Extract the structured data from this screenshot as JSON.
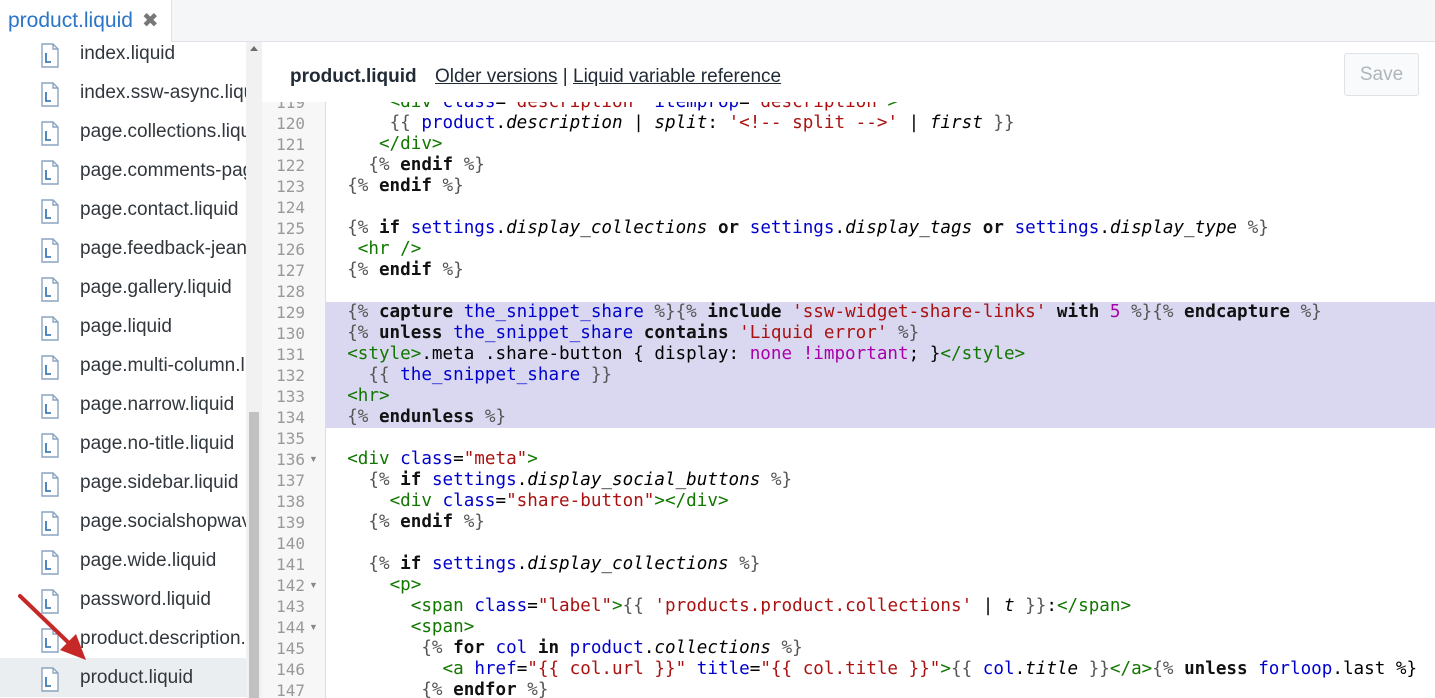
{
  "tab": {
    "label": "product.liquid",
    "close": "✖"
  },
  "sidebar": {
    "files": [
      {
        "label": "index.liquid"
      },
      {
        "label": "index.ssw-async.liquid"
      },
      {
        "label": "page.collections.liquid"
      },
      {
        "label": "page.comments-page.liquid"
      },
      {
        "label": "page.contact.liquid"
      },
      {
        "label": "page.feedback-jeans.liquid"
      },
      {
        "label": "page.gallery.liquid"
      },
      {
        "label": "page.liquid"
      },
      {
        "label": "page.multi-column.liquid"
      },
      {
        "label": "page.narrow.liquid"
      },
      {
        "label": "page.no-title.liquid"
      },
      {
        "label": "page.sidebar.liquid"
      },
      {
        "label": "page.socialshopwave.liquid"
      },
      {
        "label": "page.wide.liquid"
      },
      {
        "label": "password.liquid"
      },
      {
        "label": "product.description.liquid"
      },
      {
        "label": "product.liquid",
        "active": true
      }
    ]
  },
  "header": {
    "title": "product.liquid",
    "older_versions": "Older versions",
    "separator": " | ",
    "liquid_reference": "Liquid variable reference",
    "save": "Save"
  },
  "code": {
    "lines": [
      {
        "n": "119",
        "fold": false,
        "sel": false,
        "tokens": [
          [
            "t-txt",
            "      "
          ],
          [
            "t-tag",
            "<div"
          ],
          [
            "t-txt",
            " "
          ],
          [
            "t-attr",
            "class"
          ],
          [
            "t-txt",
            "="
          ],
          [
            "t-str",
            "\"description\""
          ],
          [
            "t-txt",
            " "
          ],
          [
            "t-attr",
            "itemprop"
          ],
          [
            "t-txt",
            "="
          ],
          [
            "t-str",
            "\"description\""
          ],
          [
            "t-tag",
            ">"
          ]
        ]
      },
      {
        "n": "120",
        "fold": false,
        "sel": false,
        "tokens": [
          [
            "t-txt",
            "      "
          ],
          [
            "t-br",
            "{{"
          ],
          [
            "t-txt",
            " "
          ],
          [
            "t-var",
            "product"
          ],
          [
            "t-txt",
            "."
          ],
          [
            "t-prop",
            "description"
          ],
          [
            "t-txt",
            " | "
          ],
          [
            "t-filter",
            "split"
          ],
          [
            "t-txt",
            ": "
          ],
          [
            "t-str",
            "'<!-- split -->'"
          ],
          [
            "t-txt",
            " | "
          ],
          [
            "t-filter",
            "first"
          ],
          [
            "t-txt",
            " "
          ],
          [
            "t-br",
            "}}"
          ]
        ]
      },
      {
        "n": "121",
        "fold": false,
        "sel": false,
        "tokens": [
          [
            "t-txt",
            "     "
          ],
          [
            "t-tag",
            "</div>"
          ]
        ]
      },
      {
        "n": "122",
        "fold": false,
        "sel": false,
        "tokens": [
          [
            "t-txt",
            "    "
          ],
          [
            "t-br",
            "{%"
          ],
          [
            "t-txt",
            " "
          ],
          [
            "t-kw",
            "endif"
          ],
          [
            "t-txt",
            " "
          ],
          [
            "t-br",
            "%}"
          ]
        ]
      },
      {
        "n": "123",
        "fold": false,
        "sel": false,
        "tokens": [
          [
            "t-txt",
            "  "
          ],
          [
            "t-br",
            "{%"
          ],
          [
            "t-txt",
            " "
          ],
          [
            "t-kw",
            "endif"
          ],
          [
            "t-txt",
            " "
          ],
          [
            "t-br",
            "%}"
          ]
        ]
      },
      {
        "n": "124",
        "fold": false,
        "sel": false,
        "tokens": []
      },
      {
        "n": "125",
        "fold": false,
        "sel": false,
        "tokens": [
          [
            "t-txt",
            "  "
          ],
          [
            "t-br",
            "{%"
          ],
          [
            "t-txt",
            " "
          ],
          [
            "t-kw",
            "if"
          ],
          [
            "t-txt",
            " "
          ],
          [
            "t-var",
            "settings"
          ],
          [
            "t-txt",
            "."
          ],
          [
            "t-prop",
            "display_collections"
          ],
          [
            "t-txt",
            " "
          ],
          [
            "t-kw",
            "or"
          ],
          [
            "t-txt",
            " "
          ],
          [
            "t-var",
            "settings"
          ],
          [
            "t-txt",
            "."
          ],
          [
            "t-prop",
            "display_tags"
          ],
          [
            "t-txt",
            " "
          ],
          [
            "t-kw",
            "or"
          ],
          [
            "t-txt",
            " "
          ],
          [
            "t-var",
            "settings"
          ],
          [
            "t-txt",
            "."
          ],
          [
            "t-prop",
            "display_type"
          ],
          [
            "t-txt",
            " "
          ],
          [
            "t-br",
            "%}"
          ]
        ]
      },
      {
        "n": "126",
        "fold": false,
        "sel": false,
        "tokens": [
          [
            "t-txt",
            "   "
          ],
          [
            "t-tag",
            "<hr />"
          ]
        ]
      },
      {
        "n": "127",
        "fold": false,
        "sel": false,
        "tokens": [
          [
            "t-txt",
            "  "
          ],
          [
            "t-br",
            "{%"
          ],
          [
            "t-txt",
            " "
          ],
          [
            "t-kw",
            "endif"
          ],
          [
            "t-txt",
            " "
          ],
          [
            "t-br",
            "%}"
          ]
        ]
      },
      {
        "n": "128",
        "fold": false,
        "sel": false,
        "tokens": []
      },
      {
        "n": "129",
        "fold": false,
        "sel": true,
        "tokens": [
          [
            "t-txt",
            "  "
          ],
          [
            "t-br",
            "{%"
          ],
          [
            "t-txt",
            " "
          ],
          [
            "t-kw",
            "capture"
          ],
          [
            "t-txt",
            " "
          ],
          [
            "t-var",
            "the_snippet_share"
          ],
          [
            "t-txt",
            " "
          ],
          [
            "t-br",
            "%}{%"
          ],
          [
            "t-txt",
            " "
          ],
          [
            "t-kw",
            "include"
          ],
          [
            "t-txt",
            " "
          ],
          [
            "t-str",
            "'ssw-widget-share-links'"
          ],
          [
            "t-txt",
            " "
          ],
          [
            "t-kw",
            "with"
          ],
          [
            "t-txt",
            " "
          ],
          [
            "t-num",
            "5"
          ],
          [
            "t-txt",
            " "
          ],
          [
            "t-br",
            "%}{%"
          ],
          [
            "t-txt",
            " "
          ],
          [
            "t-kw",
            "endcapture"
          ],
          [
            "t-txt",
            " "
          ],
          [
            "t-br",
            "%}"
          ]
        ]
      },
      {
        "n": "130",
        "fold": false,
        "sel": true,
        "tokens": [
          [
            "t-txt",
            "  "
          ],
          [
            "t-br",
            "{%"
          ],
          [
            "t-txt",
            " "
          ],
          [
            "t-kw",
            "unless"
          ],
          [
            "t-txt",
            " "
          ],
          [
            "t-var",
            "the_snippet_share"
          ],
          [
            "t-txt",
            " "
          ],
          [
            "t-kw",
            "contains"
          ],
          [
            "t-txt",
            " "
          ],
          [
            "t-str",
            "'Liquid error'"
          ],
          [
            "t-txt",
            " "
          ],
          [
            "t-br",
            "%}"
          ]
        ]
      },
      {
        "n": "131",
        "fold": false,
        "sel": true,
        "tokens": [
          [
            "t-txt",
            "  "
          ],
          [
            "t-tag",
            "<style>"
          ],
          [
            "t-txt",
            ".meta .share-button { display: "
          ],
          [
            "t-atom",
            "none"
          ],
          [
            "t-txt",
            " "
          ],
          [
            "t-atom",
            "!important"
          ],
          [
            "t-txt",
            "; }"
          ],
          [
            "t-tag",
            "</style>"
          ]
        ]
      },
      {
        "n": "132",
        "fold": false,
        "sel": true,
        "tokens": [
          [
            "t-txt",
            "    "
          ],
          [
            "t-br",
            "{{"
          ],
          [
            "t-txt",
            " "
          ],
          [
            "t-var",
            "the_snippet_share"
          ],
          [
            "t-txt",
            " "
          ],
          [
            "t-br",
            "}}"
          ]
        ]
      },
      {
        "n": "133",
        "fold": false,
        "sel": true,
        "tokens": [
          [
            "t-txt",
            "  "
          ],
          [
            "t-tag",
            "<hr>"
          ]
        ]
      },
      {
        "n": "134",
        "fold": false,
        "sel": true,
        "tokens": [
          [
            "t-txt",
            "  "
          ],
          [
            "t-br",
            "{%"
          ],
          [
            "t-txt",
            " "
          ],
          [
            "t-kw",
            "endunless"
          ],
          [
            "t-txt",
            " "
          ],
          [
            "t-br",
            "%}"
          ]
        ]
      },
      {
        "n": "135",
        "fold": false,
        "sel": false,
        "tokens": []
      },
      {
        "n": "136",
        "fold": true,
        "sel": false,
        "tokens": [
          [
            "t-txt",
            "  "
          ],
          [
            "t-tag",
            "<div"
          ],
          [
            "t-txt",
            " "
          ],
          [
            "t-attr",
            "class"
          ],
          [
            "t-txt",
            "="
          ],
          [
            "t-str",
            "\"meta\""
          ],
          [
            "t-tag",
            ">"
          ]
        ]
      },
      {
        "n": "137",
        "fold": false,
        "sel": false,
        "tokens": [
          [
            "t-txt",
            "    "
          ],
          [
            "t-br",
            "{%"
          ],
          [
            "t-txt",
            " "
          ],
          [
            "t-kw",
            "if"
          ],
          [
            "t-txt",
            " "
          ],
          [
            "t-var",
            "settings"
          ],
          [
            "t-txt",
            "."
          ],
          [
            "t-prop",
            "display_social_buttons"
          ],
          [
            "t-txt",
            " "
          ],
          [
            "t-br",
            "%}"
          ]
        ]
      },
      {
        "n": "138",
        "fold": false,
        "sel": false,
        "tokens": [
          [
            "t-txt",
            "      "
          ],
          [
            "t-tag",
            "<div"
          ],
          [
            "t-txt",
            " "
          ],
          [
            "t-attr",
            "class"
          ],
          [
            "t-txt",
            "="
          ],
          [
            "t-str",
            "\"share-button\""
          ],
          [
            "t-tag",
            "></div>"
          ]
        ]
      },
      {
        "n": "139",
        "fold": false,
        "sel": false,
        "tokens": [
          [
            "t-txt",
            "    "
          ],
          [
            "t-br",
            "{%"
          ],
          [
            "t-txt",
            " "
          ],
          [
            "t-kw",
            "endif"
          ],
          [
            "t-txt",
            " "
          ],
          [
            "t-br",
            "%}"
          ]
        ]
      },
      {
        "n": "140",
        "fold": false,
        "sel": false,
        "tokens": []
      },
      {
        "n": "141",
        "fold": false,
        "sel": false,
        "tokens": [
          [
            "t-txt",
            "    "
          ],
          [
            "t-br",
            "{%"
          ],
          [
            "t-txt",
            " "
          ],
          [
            "t-kw",
            "if"
          ],
          [
            "t-txt",
            " "
          ],
          [
            "t-var",
            "settings"
          ],
          [
            "t-txt",
            "."
          ],
          [
            "t-prop",
            "display_collections"
          ],
          [
            "t-txt",
            " "
          ],
          [
            "t-br",
            "%}"
          ]
        ]
      },
      {
        "n": "142",
        "fold": true,
        "sel": false,
        "tokens": [
          [
            "t-txt",
            "      "
          ],
          [
            "t-tag",
            "<p>"
          ]
        ]
      },
      {
        "n": "143",
        "fold": false,
        "sel": false,
        "tokens": [
          [
            "t-txt",
            "        "
          ],
          [
            "t-tag",
            "<span"
          ],
          [
            "t-txt",
            " "
          ],
          [
            "t-attr",
            "class"
          ],
          [
            "t-txt",
            "="
          ],
          [
            "t-str",
            "\"label\""
          ],
          [
            "t-tag",
            ">"
          ],
          [
            "t-br",
            "{{"
          ],
          [
            "t-txt",
            " "
          ],
          [
            "t-str",
            "'products.product.collections'"
          ],
          [
            "t-txt",
            " | "
          ],
          [
            "t-filter",
            "t"
          ],
          [
            "t-txt",
            " "
          ],
          [
            "t-br",
            "}}"
          ],
          [
            "t-txt",
            ":"
          ],
          [
            "t-tag",
            "</span>"
          ]
        ]
      },
      {
        "n": "144",
        "fold": true,
        "sel": false,
        "tokens": [
          [
            "t-txt",
            "        "
          ],
          [
            "t-tag",
            "<span>"
          ]
        ]
      },
      {
        "n": "145",
        "fold": false,
        "sel": false,
        "tokens": [
          [
            "t-txt",
            "         "
          ],
          [
            "t-br",
            "{%"
          ],
          [
            "t-txt",
            " "
          ],
          [
            "t-kw",
            "for"
          ],
          [
            "t-txt",
            " "
          ],
          [
            "t-var",
            "col"
          ],
          [
            "t-txt",
            " "
          ],
          [
            "t-kw",
            "in"
          ],
          [
            "t-txt",
            " "
          ],
          [
            "t-var",
            "product"
          ],
          [
            "t-txt",
            "."
          ],
          [
            "t-prop",
            "collections"
          ],
          [
            "t-txt",
            " "
          ],
          [
            "t-br",
            "%}"
          ]
        ]
      },
      {
        "n": "146",
        "fold": false,
        "sel": false,
        "tokens": [
          [
            "t-txt",
            "           "
          ],
          [
            "t-tag",
            "<a"
          ],
          [
            "t-txt",
            " "
          ],
          [
            "t-attr",
            "href"
          ],
          [
            "t-txt",
            "="
          ],
          [
            "t-str",
            "\"{{ col.url }}\""
          ],
          [
            "t-txt",
            " "
          ],
          [
            "t-attr",
            "title"
          ],
          [
            "t-txt",
            "="
          ],
          [
            "t-str",
            "\"{{ col.title }}\""
          ],
          [
            "t-tag",
            ">"
          ],
          [
            "t-br",
            "{{"
          ],
          [
            "t-txt",
            " "
          ],
          [
            "t-var",
            "col"
          ],
          [
            "t-txt",
            "."
          ],
          [
            "t-prop",
            "title"
          ],
          [
            "t-txt",
            " "
          ],
          [
            "t-br",
            "}}"
          ],
          [
            "t-tag",
            "</a>"
          ],
          [
            "t-br",
            "{%"
          ],
          [
            "t-txt",
            " "
          ],
          [
            "t-kw",
            "unless"
          ],
          [
            "t-txt",
            " "
          ],
          [
            "t-var",
            "forloop"
          ],
          [
            "t-txt",
            ".last %}"
          ]
        ]
      },
      {
        "n": "147",
        "fold": false,
        "sel": false,
        "tokens": [
          [
            "t-txt",
            "         "
          ],
          [
            "t-br",
            "{%"
          ],
          [
            "t-txt",
            " "
          ],
          [
            "t-kw",
            "endfor"
          ],
          [
            "t-txt",
            " "
          ],
          [
            "t-br",
            "%}"
          ]
        ]
      }
    ]
  }
}
